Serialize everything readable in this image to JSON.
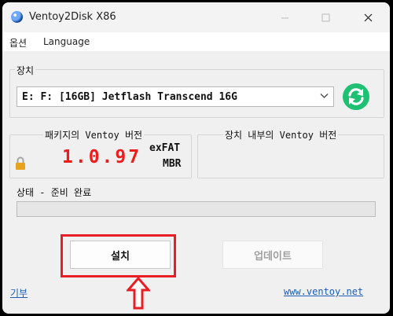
{
  "window": {
    "title": "Ventoy2Disk  X86",
    "icon": "ventoy-logo-icon",
    "controls": [
      "minimize-icon",
      "maximize-icon",
      "close-icon"
    ]
  },
  "menu": {
    "options": "옵션",
    "language": "Language"
  },
  "device": {
    "label": "장치",
    "selected": "E: F: [16GB] Jetflash Transcend 16G",
    "refresh_icon": "refresh-icon"
  },
  "package_version": {
    "label": "패키지의 Ventoy 버전",
    "version": "1.0.97",
    "filesystem": "exFAT",
    "partition_style": "MBR",
    "icon": "lock-icon"
  },
  "device_version": {
    "label": "장치 내부의 Ventoy 버전",
    "version": ""
  },
  "status": {
    "label": "상태 - 준비 완료",
    "progress": 0
  },
  "buttons": {
    "install": "설치",
    "update": "업데이트"
  },
  "footer": {
    "donate": "기부",
    "website": "www.ventoy.net"
  },
  "annotation": {
    "highlight_color": "#e81e25",
    "arrow_icon": "up-arrow-icon"
  },
  "colors": {
    "version": "#ee1c1c",
    "refresh": "#1ec071",
    "link": "#1a5fb4"
  }
}
